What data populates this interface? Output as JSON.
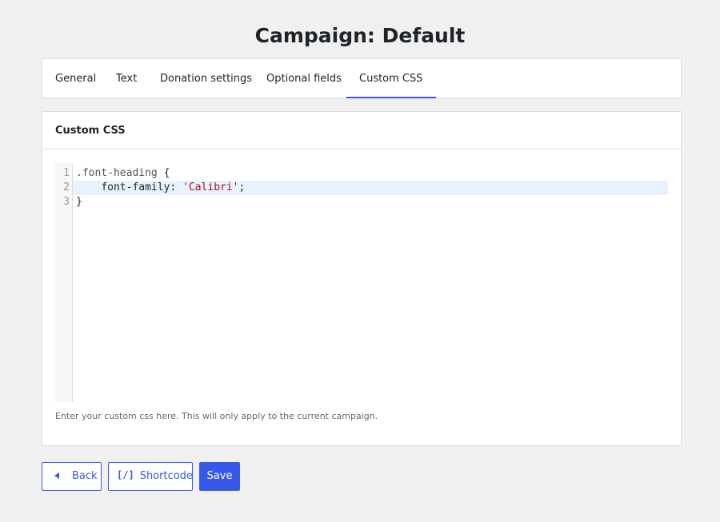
{
  "page": {
    "title": "Campaign: Default"
  },
  "tabs": [
    {
      "label": "General"
    },
    {
      "label": "Text"
    },
    {
      "label": "Donation settings"
    },
    {
      "label": "Optional fields"
    },
    {
      "label": "Custom CSS",
      "active": true
    }
  ],
  "panel": {
    "title": "Custom CSS",
    "help_text": "Enter your custom css here. This will only apply to the current campaign."
  },
  "editor": {
    "line_numbers": [
      "1",
      "2",
      "3"
    ],
    "lines": {
      "l1_selector": ".font-heading",
      "l1_brace": " {",
      "l2_indent": "    ",
      "l2_property": "font-family:",
      "l2_space": " ",
      "l2_value": "'Calibri'",
      "l2_semicolon": ";",
      "l3_brace": "}"
    },
    "active_line": 2
  },
  "actions": {
    "back_label": "Back",
    "shortcode_label": "Shortcode",
    "shortcode_icon_text": "[/]",
    "save_label": "Save"
  },
  "colors": {
    "accent": "#3858e9",
    "background": "#f0f0f1",
    "active_line": "#e8f2fe",
    "string": "#aa1111"
  }
}
